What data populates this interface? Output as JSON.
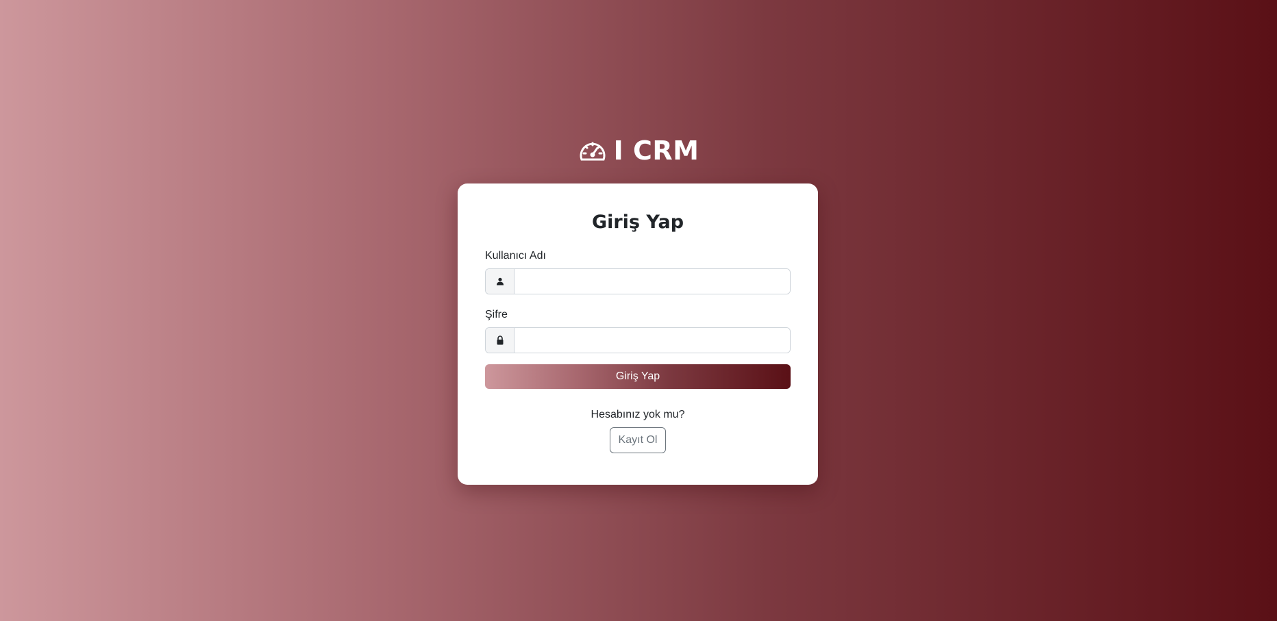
{
  "brand": {
    "icon": "speedometer-icon",
    "title": "I CRM"
  },
  "login": {
    "title": "Giriş Yap",
    "username_label": "Kullanıcı Adı",
    "username_icon": "person-icon",
    "username_value": "",
    "password_label": "Şifre",
    "password_icon": "lock-icon",
    "password_value": "",
    "submit_label": "Giriş Yap",
    "signup_prompt": "Hesabınız yok mu?",
    "signup_label": "Kayıt Ol"
  },
  "colors": {
    "gradient_start": "#cd979c",
    "gradient_end": "#5a1016",
    "card_background": "#ffffff",
    "text_primary": "#212529",
    "secondary": "#6c757d"
  }
}
